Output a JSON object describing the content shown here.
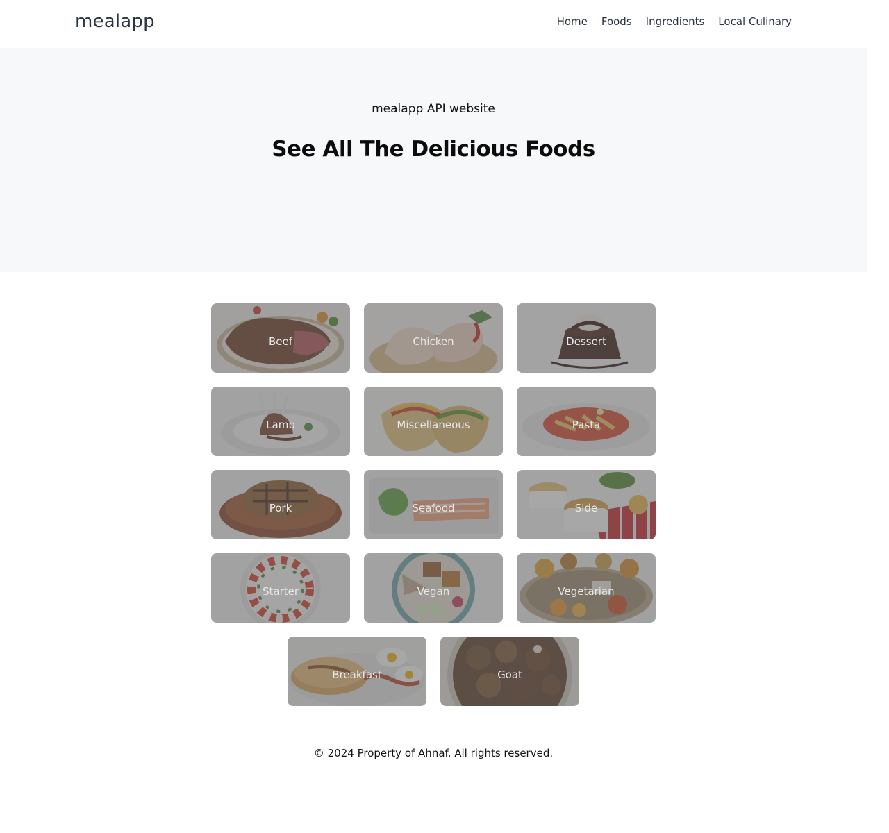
{
  "header": {
    "logo": "mealapp",
    "nav": [
      "Home",
      "Foods",
      "Ingredients",
      "Local Culinary"
    ]
  },
  "hero": {
    "subtitle": "mealapp API website",
    "title": "See All The Delicious Foods"
  },
  "categories": [
    {
      "label": "Beef"
    },
    {
      "label": "Chicken"
    },
    {
      "label": "Dessert"
    },
    {
      "label": "Lamb"
    },
    {
      "label": "Miscellaneous"
    },
    {
      "label": "Pasta"
    },
    {
      "label": "Pork"
    },
    {
      "label": "Seafood"
    },
    {
      "label": "Side"
    },
    {
      "label": "Starter"
    },
    {
      "label": "Vegan"
    },
    {
      "label": "Vegetarian"
    },
    {
      "label": "Breakfast"
    },
    {
      "label": "Goat"
    }
  ],
  "footer": {
    "text": "© 2024 Property of Ahnaf. All rights reserved."
  }
}
